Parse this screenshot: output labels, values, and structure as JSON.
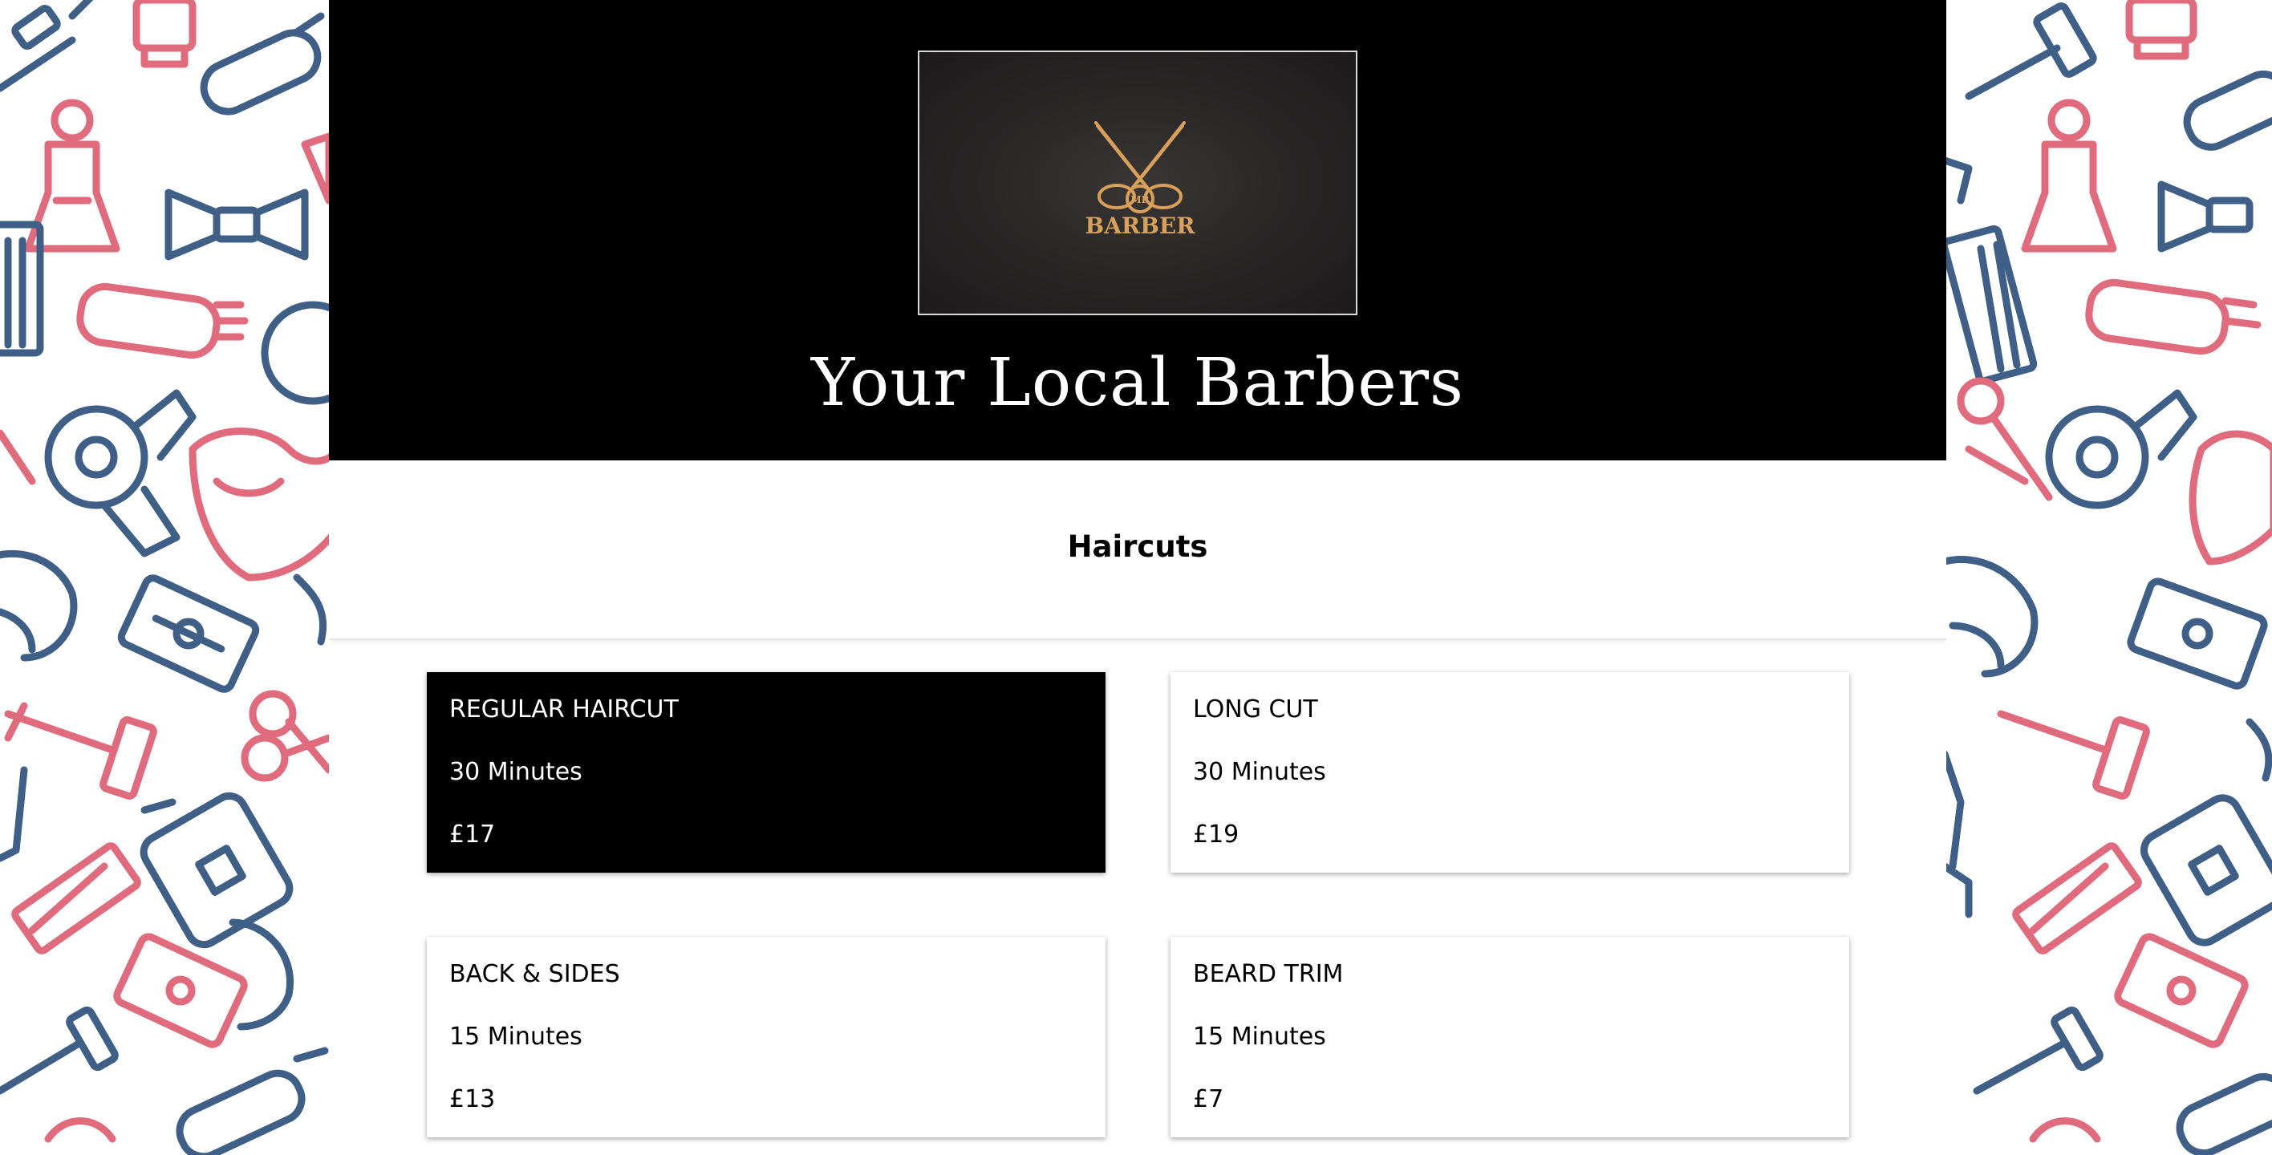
{
  "header": {
    "logo_text": "BARBER",
    "logo_monogram": "MR",
    "site_title": "Your Local Barbers"
  },
  "services": {
    "section_title": "Haircuts",
    "items": [
      {
        "name": "REGULAR HAIRCUT",
        "duration": "30 Minutes",
        "price": "£17",
        "selected": true
      },
      {
        "name": "LONG CUT",
        "duration": "30 Minutes",
        "price": "£19",
        "selected": false
      },
      {
        "name": "BACK & SIDES",
        "duration": "15 Minutes",
        "price": "£13",
        "selected": false
      },
      {
        "name": "BEARD TRIM",
        "duration": "15 Minutes",
        "price": "£7",
        "selected": false
      }
    ]
  },
  "colors": {
    "header_bg": "#000000",
    "logo_gold": "#d9a05b",
    "pattern_pink": "#e06b7d",
    "pattern_blue": "#3f5f86",
    "selected_card_bg": "#000000"
  }
}
